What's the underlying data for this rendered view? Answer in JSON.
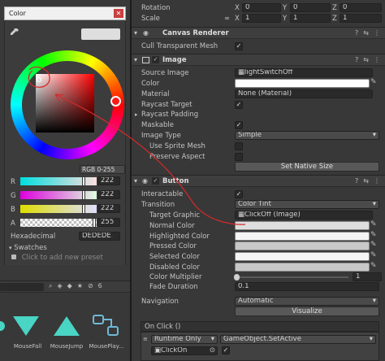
{
  "transform": {
    "rotation_label": "Rotation",
    "scale_label": "Scale",
    "rotation": {
      "x": "0",
      "y": "0",
      "z": "0"
    },
    "scale": {
      "x": "1",
      "y": "1",
      "z": "1"
    }
  },
  "canvas_renderer": {
    "title": "Canvas Renderer",
    "cull_label": "Cull Transparent Mesh"
  },
  "image": {
    "title": "Image",
    "rows": [
      {
        "label": "Source Image",
        "value": "lightSwitchOff"
      },
      {
        "label": "Color",
        "value": ""
      },
      {
        "label": "Material",
        "value": "None (Material)"
      },
      {
        "label": "Raycast Target",
        "value": ""
      },
      {
        "label": "Raycast Padding",
        "value": ""
      },
      {
        "label": "Maskable",
        "value": ""
      },
      {
        "label": "Image Type",
        "value": "Simple"
      },
      {
        "label": "Use Sprite Mesh",
        "value": ""
      },
      {
        "label": "Preserve Aspect",
        "value": ""
      }
    ],
    "set_native_size": "Set Native Size"
  },
  "button": {
    "title": "Button",
    "interactable_label": "Interactable",
    "transition_label": "Transition",
    "transition_value": "Color Tint",
    "target_graphic_label": "Target Graphic",
    "target_graphic_value": "ClickOff (Image)",
    "colors": [
      {
        "label": "Normal Color",
        "hex": "#dedede"
      },
      {
        "label": "Highlighted Color",
        "hex": "#f5f5f5"
      },
      {
        "label": "Pressed Color",
        "hex": "#c8c8c8"
      },
      {
        "label": "Selected Color",
        "hex": "#f5f5f5"
      },
      {
        "label": "Disabled Color",
        "hex": "#c8c8c8"
      }
    ],
    "multiplier_label": "Color Multiplier",
    "multiplier_value": "1",
    "fade_label": "Fade Duration",
    "fade_value": "0.1",
    "navigation_label": "Navigation",
    "navigation_value": "Automatic",
    "visualize": "Visualize",
    "onclick_label": "On Click ()",
    "runtime_value": "Runtime Only",
    "function_value": "GameObject.SetActive",
    "object_value": "ClickOn"
  },
  "color_picker": {
    "title": "Color",
    "mode": "RGB 0-255",
    "channels": [
      {
        "label": "R",
        "value": "222"
      },
      {
        "label": "G",
        "value": "222"
      },
      {
        "label": "B",
        "value": "222"
      },
      {
        "label": "A",
        "value": "255"
      }
    ],
    "hex_label": "Hexadecimal",
    "hex_value": "DEDEDE",
    "swatches_label": "Swatches",
    "add_preset": "Click to add new preset"
  },
  "project": {
    "count": "6",
    "items": [
      {
        "label": "MouseFall"
      },
      {
        "label": "MouseJump"
      },
      {
        "label": "MousePlay..."
      }
    ]
  },
  "colors": {
    "accent_annotation": "#d42a2a",
    "close_button": "#c94040",
    "tile_teal": "#49d4c4"
  }
}
